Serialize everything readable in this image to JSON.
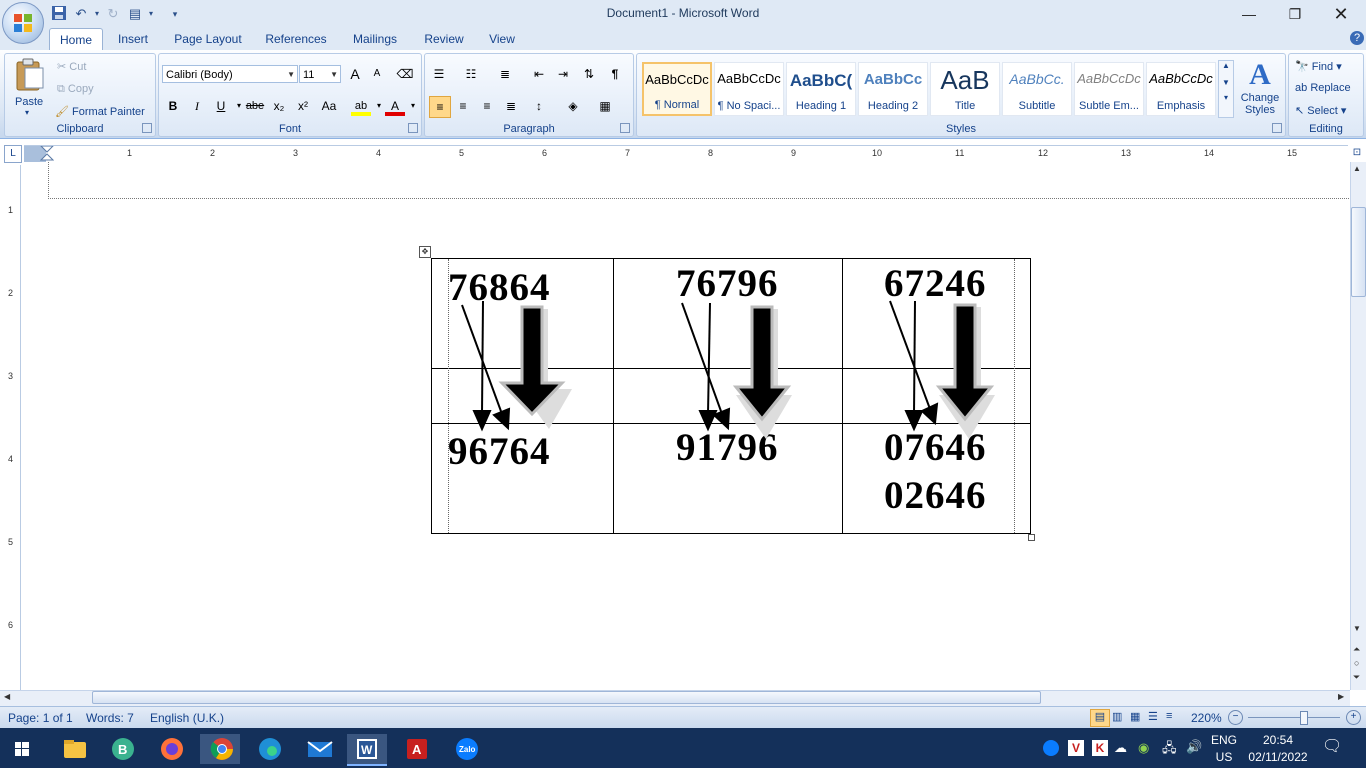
{
  "window": {
    "title": "Document1 - Microsoft Word"
  },
  "tabs": [
    "Home",
    "Insert",
    "Page Layout",
    "References",
    "Mailings",
    "Review",
    "View"
  ],
  "clipboard": {
    "paste": "Paste",
    "cut": "Cut",
    "copy": "Copy",
    "format_painter": "Format Painter",
    "label": "Clipboard"
  },
  "font": {
    "name": "Calibri (Body)",
    "size": "11",
    "label": "Font",
    "bold": "B",
    "italic": "I",
    "underline": "U",
    "strike": "abe",
    "sub": "x₂",
    "sup": "x²",
    "case": "Aa",
    "grow": "A",
    "shrink": "A"
  },
  "paragraph": {
    "label": "Paragraph"
  },
  "styles": {
    "label": "Styles",
    "items": [
      {
        "sample": "AaBbCcDc",
        "name": "¶ Normal"
      },
      {
        "sample": "AaBbCcDc",
        "name": "¶ No Spaci..."
      },
      {
        "sample": "AaBbC(",
        "name": "Heading 1"
      },
      {
        "sample": "AaBbCc",
        "name": "Heading 2"
      },
      {
        "sample": "AaB",
        "name": "Title"
      },
      {
        "sample": "AaBbCc.",
        "name": "Subtitle"
      },
      {
        "sample": "AaBbCcDc",
        "name": "Subtle Em..."
      },
      {
        "sample": "AaBbCcDc",
        "name": "Emphasis"
      }
    ],
    "change_styles": "Change Styles"
  },
  "editing": {
    "label": "Editing",
    "find": "Find",
    "replace": "Replace",
    "select": "Select"
  },
  "ruler": {
    "numbers": [
      "1",
      "2",
      "3",
      "4",
      "5",
      "6",
      "7",
      "8",
      "9",
      "10",
      "11",
      "12",
      "13",
      "14",
      "15"
    ],
    "vnumbers": [
      "1",
      "2",
      "3",
      "4",
      "5",
      "6"
    ]
  },
  "table": {
    "cells": [
      {
        "top": "76864",
        "bottom": [
          "96764"
        ]
      },
      {
        "top": "76796",
        "bottom": [
          "91796"
        ]
      },
      {
        "top": "67246",
        "bottom": [
          "07646",
          "02646"
        ]
      }
    ]
  },
  "status": {
    "page": "Page: 1 of 1",
    "words": "Words: 7",
    "language": "English (U.K.)",
    "zoom": "220%"
  },
  "taskbar": {
    "lang": "ENG",
    "region": "US",
    "time": "20:54",
    "date": "02/11/2022"
  }
}
